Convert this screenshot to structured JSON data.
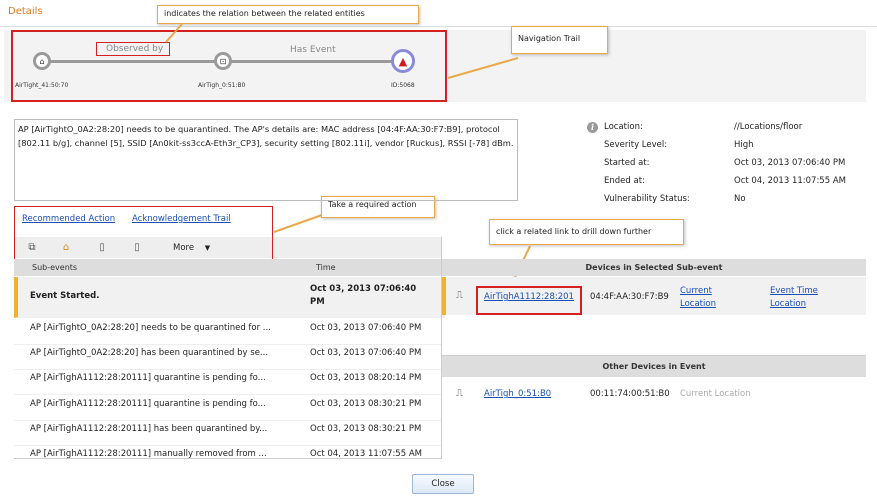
{
  "header": {
    "title": "Details"
  },
  "callouts": {
    "relation": "indicates the relation between the related entities",
    "nav_trail": "Navigation Trail",
    "action": "Take a required action",
    "drill": "click a related link to drill down further"
  },
  "nav_trail": {
    "nodes": [
      {
        "label": "AirTight_41:50:70",
        "icon": "access-point-icon"
      },
      {
        "label": "AirTigh_0:51:B0",
        "icon": "router-icon"
      },
      {
        "label": "ID:5068",
        "icon": "alert-triangle-icon"
      }
    ],
    "relations": [
      "Observed by",
      "Has Event"
    ]
  },
  "event": {
    "description": "AP [AirTightO_0A2:28:20] needs to be quarantined. The AP's details are: MAC address [04:4F:AA:30:F7:B9], protocol [802.11 b/g], channel [5], SSID [An0kit-ss3ccA-Eth3r_CP3], security setting [802.11i], vendor [Ruckus], RSSI [-78] dBm.",
    "details": [
      {
        "label": "Location:",
        "value": "//Locations/floor"
      },
      {
        "label": "Severity Level:",
        "value": "High"
      },
      {
        "label": "Started at:",
        "value": "Oct 03, 2013 07:06:40 PM"
      },
      {
        "label": "Ended at:",
        "value": "Oct 04, 2013 11:07:55 AM"
      },
      {
        "label": "Vulnerability Status:",
        "value": "No"
      }
    ]
  },
  "actions": {
    "recommended": "Recommended Action",
    "ack_trail": "Acknowledgement Trail",
    "more": "More"
  },
  "subevents": {
    "columns": [
      "Sub-events",
      "Time"
    ],
    "rows": [
      {
        "text": "Event Started.",
        "time": "Oct 03, 2013 07:06:40 PM"
      },
      {
        "text": "AP [AirTightO_0A2:28:20] needs to be quarantined for ...",
        "time": "Oct 03, 2013 07:06:40 PM"
      },
      {
        "text": "AP [AirTightO_0A2:28:20] has been quarantined by se...",
        "time": "Oct 03, 2013 07:06:40 PM"
      },
      {
        "text": "AP [AirTighA1112:28:20111] quarantine is pending fo...",
        "time": "Oct 03, 2013 08:20:14 PM"
      },
      {
        "text": "AP [AirTighA1112:28:20111] quarantine is pending fo...",
        "time": "Oct 03, 2013 08:30:21 PM"
      },
      {
        "text": "AP [AirTighA1112:28:20111] has been quarantined by...",
        "time": "Oct 03, 2013 08:30:21 PM"
      },
      {
        "text": "AP [AirTighA1112:28:20111] manually removed from ...",
        "time": "Oct 04, 2013 11:07:55 AM"
      }
    ]
  },
  "devices_selected": {
    "title": "Devices in Selected Sub-event",
    "device": {
      "name": "AirTighA1112:28:201",
      "mac": "04:4F:AA:30:F7:B9",
      "loc_link": "Current Location",
      "evt_link": "Event Time Location"
    }
  },
  "other_devices": {
    "title": "Other Devices in Event",
    "device": {
      "name": "AirTigh_0:51:B0",
      "mac": "00:11:74:00:51:B0",
      "loc": "Current Location"
    }
  },
  "footer": {
    "close": "Close"
  }
}
